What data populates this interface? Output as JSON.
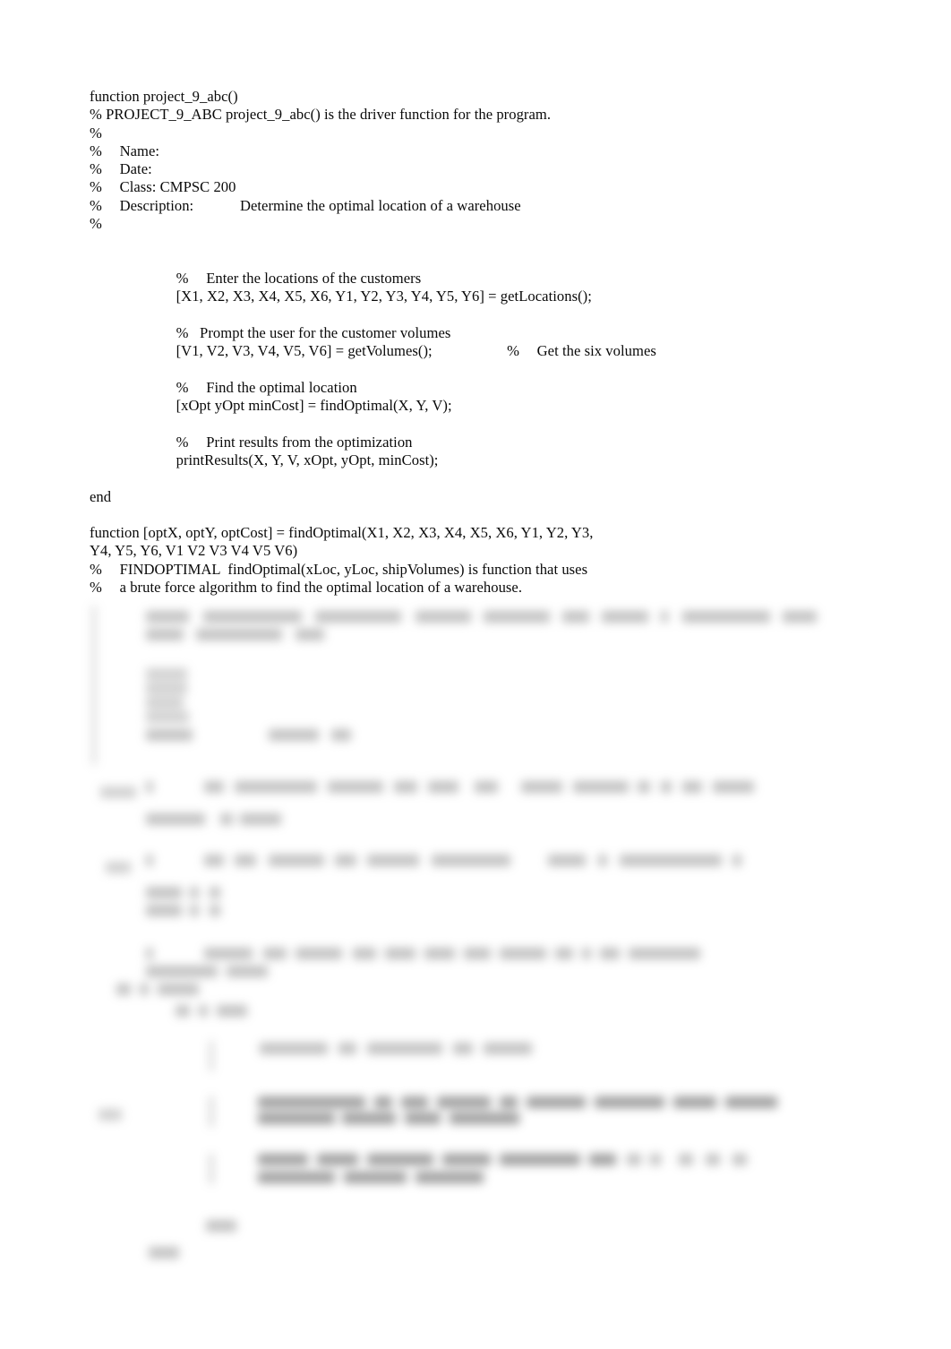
{
  "document": {
    "type": "matlab-source-listing",
    "background_color": "#ffffff",
    "text_color": "#0a0a0a"
  },
  "code": {
    "lines": [
      "function project_9_abc()",
      "% PROJECT_9_ABC project_9_abc() is the driver function for the program.",
      "%",
      "%\tName:",
      "%\tDate:",
      "%\tClass: CMPSC 200",
      "%\tDescription:\t\tDetermine the optimal location of a warehouse",
      "%",
      "",
      "",
      "\t%\tEnter the locations of the customers",
      "\t[X1, X2, X3, X4, X5, X6, Y1, Y2, Y3, Y4, Y5, Y6] = getLocations();",
      "",
      "\t%   Prompt the user for the customer volumes",
      "\t[V1, V2, V3, V4, V5, V6] = getVolumes();\t\t\t%\tGet the six volumes",
      "",
      "\t%\tFind the optimal location",
      "\t[xOpt yOpt minCost] = findOptimal(X, Y, V);",
      "",
      "\t%\tPrint results from the optimization",
      "\tprintResults(X, Y, V, xOpt, yOpt, minCost);",
      "",
      "end",
      "",
      "function [optX, optY, optCost] = findOptimal(X1, X2, X3, X4, X5, X6, Y1, Y2, Y3,",
      "Y4, Y5, Y6, V1 V2 V3 V4 V5 V6)",
      "%\tFINDOPTIMAL  findOptimal(xLoc, yLoc, shipVolumes) is function that uses",
      "%\ta brute force algorithm to find the optimal location of a warehouse."
    ]
  },
  "redacted": {
    "description": "blurred unreadable source code continuation",
    "note": "text illegible due to heavy gaussian blur"
  }
}
